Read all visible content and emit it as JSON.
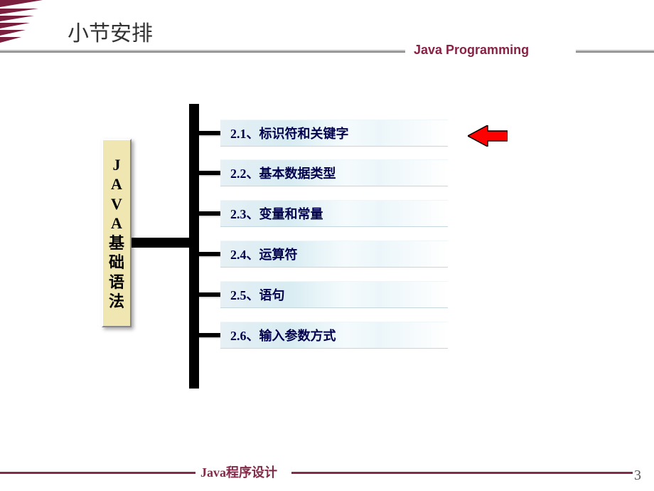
{
  "title": "小节安排",
  "subtitle": "Java Programming",
  "sideLabel": "JAVA基础语法",
  "sections": {
    "s1": "2.1、标识符和关键字",
    "s2": "2.2、基本数据类型",
    "s3": "2.3、变量和常量",
    "s4": "2.4、运算符",
    "s5": "2.5、语句",
    "s6": "2.6、输入参数方式"
  },
  "footer": "Java程序设计",
  "pageNumber": "3",
  "colors": {
    "accent": "#842a4a",
    "itemBg": "#e6f0f5",
    "labelBg": "#f0e6b2"
  }
}
